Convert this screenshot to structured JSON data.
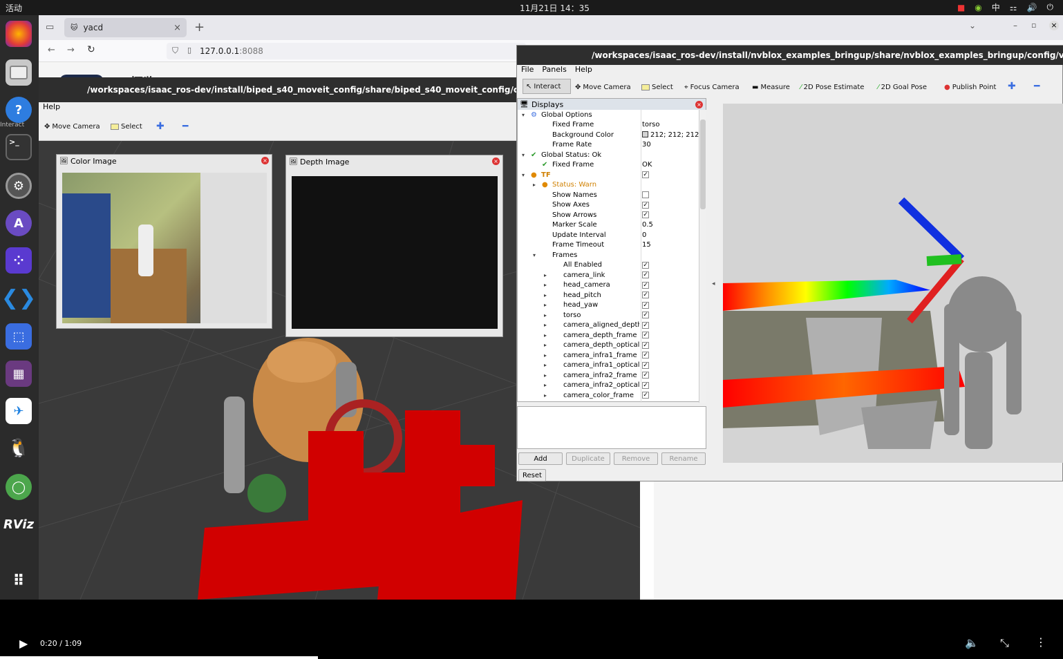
{
  "topbar": {
    "activities": "活动",
    "clock": "11月21日  14：35",
    "input_method": "中"
  },
  "dock": {
    "items": [
      "firefox-icon",
      "files-icon",
      "help-icon",
      "terminal-icon",
      "settings-icon",
      "app-store-icon",
      "flathub-icon",
      "vscode-icon",
      "screenshot-icon",
      "video-editor-icon",
      "feishu-icon",
      "qq-icon",
      "zoom-icon",
      "rviz-icon",
      "app-grid-icon"
    ]
  },
  "browser": {
    "tab_title": "yacd",
    "url_host": "127.0.0.1",
    "url_port": ":8088",
    "page_heading": "概览"
  },
  "rviz_left": {
    "title": "/workspaces/isaac_ros-dev/install/biped_s40_moveit_config/share/biped_s40_moveit_config/config/moveit.rv",
    "menu_help": "Help",
    "side_label": "Interact",
    "tools": {
      "move_camera": "Move Camera",
      "select": "Select"
    },
    "color_image": "Color Image",
    "depth_image": "Depth Image"
  },
  "rviz_right": {
    "title": "/workspaces/isaac_ros-dev/install/nvblox_examples_bringup/share/nvblox_examples_bringup/config/visualization/kuavo",
    "menu": [
      "File",
      "Panels",
      "Help"
    ],
    "tools": [
      "Interact",
      "Move Camera",
      "Select",
      "Focus Camera",
      "Measure",
      "2D Pose Estimate",
      "2D Goal Pose",
      "Publish Point"
    ],
    "displays_title": "Displays",
    "rows": [
      {
        "name": "Global Options",
        "value": "",
        "indent": 0,
        "arrow": "down",
        "icon": "gear"
      },
      {
        "name": "Fixed Frame",
        "value": "torso",
        "indent": 1
      },
      {
        "name": "Background Color",
        "value": "212; 212; 212",
        "indent": 1,
        "swatch": true
      },
      {
        "name": "Frame Rate",
        "value": "30",
        "indent": 1
      },
      {
        "name": "Global Status: Ok",
        "value": "",
        "indent": 0,
        "arrow": "down",
        "icon": "check"
      },
      {
        "name": "Fixed Frame",
        "value": "OK",
        "indent": 1,
        "icon": "check"
      },
      {
        "name": "TF",
        "value": "",
        "indent": 0,
        "arrow": "down",
        "icon": "warn",
        "checked": true,
        "warn": true
      },
      {
        "name": "Status: Warn",
        "value": "",
        "indent": 1,
        "arrow": "right",
        "icon": "warn",
        "warn": true
      },
      {
        "name": "Show Names",
        "value": "",
        "indent": 1,
        "checked": false
      },
      {
        "name": "Show Axes",
        "value": "",
        "indent": 1,
        "checked": true
      },
      {
        "name": "Show Arrows",
        "value": "",
        "indent": 1,
        "checked": true
      },
      {
        "name": "Marker Scale",
        "value": "0.5",
        "indent": 1
      },
      {
        "name": "Update Interval",
        "value": "0",
        "indent": 1
      },
      {
        "name": "Frame Timeout",
        "value": "15",
        "indent": 1
      },
      {
        "name": "Frames",
        "value": "",
        "indent": 1,
        "arrow": "down"
      },
      {
        "name": "All Enabled",
        "value": "",
        "indent": 2,
        "checked": true
      },
      {
        "name": "camera_link",
        "value": "",
        "indent": 2,
        "arrow": "right",
        "checked": true
      },
      {
        "name": "head_camera",
        "value": "",
        "indent": 2,
        "arrow": "right",
        "checked": true
      },
      {
        "name": "head_pitch",
        "value": "",
        "indent": 2,
        "arrow": "right",
        "checked": true
      },
      {
        "name": "head_yaw",
        "value": "",
        "indent": 2,
        "arrow": "right",
        "checked": true
      },
      {
        "name": "torso",
        "value": "",
        "indent": 2,
        "arrow": "right",
        "checked": true
      },
      {
        "name": "camera_aligned_depth_...",
        "value": "",
        "indent": 2,
        "arrow": "right",
        "checked": true
      },
      {
        "name": "camera_depth_frame",
        "value": "",
        "indent": 2,
        "arrow": "right",
        "checked": true
      },
      {
        "name": "camera_depth_optical_f...",
        "value": "",
        "indent": 2,
        "arrow": "right",
        "checked": true
      },
      {
        "name": "camera_infra1_frame",
        "value": "",
        "indent": 2,
        "arrow": "right",
        "checked": true
      },
      {
        "name": "camera_infra1_optical_f...",
        "value": "",
        "indent": 2,
        "arrow": "right",
        "checked": true
      },
      {
        "name": "camera_infra2_frame",
        "value": "",
        "indent": 2,
        "arrow": "right",
        "checked": true
      },
      {
        "name": "camera_infra2_optical_f...",
        "value": "",
        "indent": 2,
        "arrow": "right",
        "checked": true
      },
      {
        "name": "camera_color_frame",
        "value": "",
        "indent": 2,
        "arrow": "right",
        "checked": true
      }
    ],
    "buttons": {
      "add": "Add",
      "duplicate": "Duplicate",
      "remove": "Remove",
      "rename": "Rename",
      "reset": "Reset"
    }
  },
  "video": {
    "time": "0:20 / 1:09"
  }
}
